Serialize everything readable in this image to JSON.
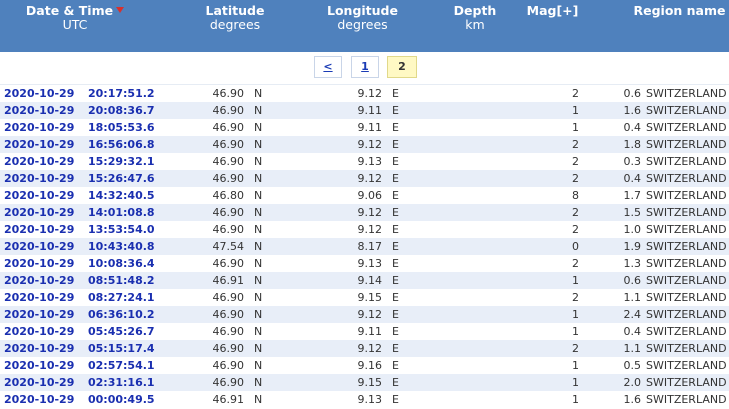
{
  "header": {
    "datetime": {
      "title": "Date & Time",
      "sub": "UTC"
    },
    "latitude": {
      "title": "Latitude",
      "sub": "degrees"
    },
    "longitude": {
      "title": "Longitude",
      "sub": "degrees"
    },
    "depth": {
      "title": "Depth",
      "sub": "km"
    },
    "mag": {
      "title": "Mag[+]"
    },
    "region": {
      "title": "Region name"
    }
  },
  "pager": {
    "prev": "<",
    "page1": "1",
    "page2": "2"
  },
  "colors": {
    "header_bg": "#4f81bd",
    "row_alt": "#e8eef8",
    "link": "#1a2fb0",
    "current_page": "#fff9c4",
    "sort_arrow": "#d9302c"
  },
  "rows": [
    {
      "date": "2020-10-29",
      "time": "20:17:51.2",
      "lat": "46.90",
      "ns": "N",
      "lon": "9.12",
      "ew": "E",
      "depth": "2",
      "mag": "0.6",
      "region": "SWITZERLAND"
    },
    {
      "date": "2020-10-29",
      "time": "20:08:36.7",
      "lat": "46.90",
      "ns": "N",
      "lon": "9.11",
      "ew": "E",
      "depth": "1",
      "mag": "1.6",
      "region": "SWITZERLAND"
    },
    {
      "date": "2020-10-29",
      "time": "18:05:53.6",
      "lat": "46.90",
      "ns": "N",
      "lon": "9.11",
      "ew": "E",
      "depth": "1",
      "mag": "0.4",
      "region": "SWITZERLAND"
    },
    {
      "date": "2020-10-29",
      "time": "16:56:06.8",
      "lat": "46.90",
      "ns": "N",
      "lon": "9.12",
      "ew": "E",
      "depth": "2",
      "mag": "1.8",
      "region": "SWITZERLAND"
    },
    {
      "date": "2020-10-29",
      "time": "15:29:32.1",
      "lat": "46.90",
      "ns": "N",
      "lon": "9.13",
      "ew": "E",
      "depth": "2",
      "mag": "0.3",
      "region": "SWITZERLAND"
    },
    {
      "date": "2020-10-29",
      "time": "15:26:47.6",
      "lat": "46.90",
      "ns": "N",
      "lon": "9.12",
      "ew": "E",
      "depth": "2",
      "mag": "0.4",
      "region": "SWITZERLAND"
    },
    {
      "date": "2020-10-29",
      "time": "14:32:40.5",
      "lat": "46.80",
      "ns": "N",
      "lon": "9.06",
      "ew": "E",
      "depth": "8",
      "mag": "1.7",
      "region": "SWITZERLAND"
    },
    {
      "date": "2020-10-29",
      "time": "14:01:08.8",
      "lat": "46.90",
      "ns": "N",
      "lon": "9.12",
      "ew": "E",
      "depth": "2",
      "mag": "1.5",
      "region": "SWITZERLAND"
    },
    {
      "date": "2020-10-29",
      "time": "13:53:54.0",
      "lat": "46.90",
      "ns": "N",
      "lon": "9.12",
      "ew": "E",
      "depth": "2",
      "mag": "1.0",
      "region": "SWITZERLAND"
    },
    {
      "date": "2020-10-29",
      "time": "10:43:40.8",
      "lat": "47.54",
      "ns": "N",
      "lon": "8.17",
      "ew": "E",
      "depth": "0",
      "mag": "1.9",
      "region": "SWITZERLAND"
    },
    {
      "date": "2020-10-29",
      "time": "10:08:36.4",
      "lat": "46.90",
      "ns": "N",
      "lon": "9.13",
      "ew": "E",
      "depth": "2",
      "mag": "1.3",
      "region": "SWITZERLAND"
    },
    {
      "date": "2020-10-29",
      "time": "08:51:48.2",
      "lat": "46.91",
      "ns": "N",
      "lon": "9.14",
      "ew": "E",
      "depth": "1",
      "mag": "0.6",
      "region": "SWITZERLAND"
    },
    {
      "date": "2020-10-29",
      "time": "08:27:24.1",
      "lat": "46.90",
      "ns": "N",
      "lon": "9.15",
      "ew": "E",
      "depth": "2",
      "mag": "1.1",
      "region": "SWITZERLAND"
    },
    {
      "date": "2020-10-29",
      "time": "06:36:10.2",
      "lat": "46.90",
      "ns": "N",
      "lon": "9.12",
      "ew": "E",
      "depth": "1",
      "mag": "2.4",
      "region": "SWITZERLAND"
    },
    {
      "date": "2020-10-29",
      "time": "05:45:26.7",
      "lat": "46.90",
      "ns": "N",
      "lon": "9.11",
      "ew": "E",
      "depth": "1",
      "mag": "0.4",
      "region": "SWITZERLAND"
    },
    {
      "date": "2020-10-29",
      "time": "05:15:17.4",
      "lat": "46.90",
      "ns": "N",
      "lon": "9.12",
      "ew": "E",
      "depth": "2",
      "mag": "1.1",
      "region": "SWITZERLAND"
    },
    {
      "date": "2020-10-29",
      "time": "02:57:54.1",
      "lat": "46.90",
      "ns": "N",
      "lon": "9.16",
      "ew": "E",
      "depth": "1",
      "mag": "0.5",
      "region": "SWITZERLAND"
    },
    {
      "date": "2020-10-29",
      "time": "02:31:16.1",
      "lat": "46.90",
      "ns": "N",
      "lon": "9.15",
      "ew": "E",
      "depth": "1",
      "mag": "2.0",
      "region": "SWITZERLAND"
    },
    {
      "date": "2020-10-29",
      "time": "00:00:49.5",
      "lat": "46.91",
      "ns": "N",
      "lon": "9.13",
      "ew": "E",
      "depth": "1",
      "mag": "1.6",
      "region": "SWITZERLAND"
    }
  ]
}
